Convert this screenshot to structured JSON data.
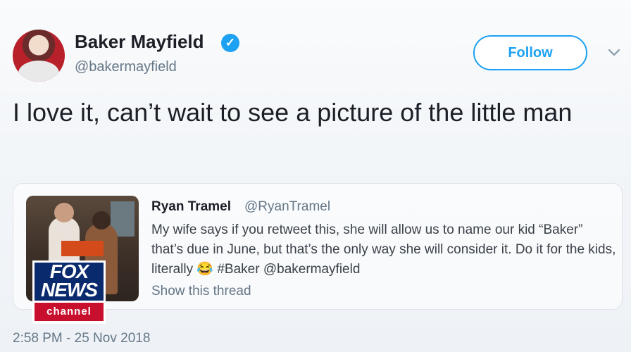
{
  "author": {
    "display_name": "Baker Mayfield",
    "handle": "@bakermayfield",
    "verified": true
  },
  "follow_label": "Follow",
  "tweet_text": "I love it, can’t wait to see a picture of the little man",
  "quoted_tweet": {
    "display_name": "Ryan Tramel",
    "handle": "@RyanTramel",
    "text_before_emoji": "My wife says if you retweet this, she will allow us to name our kid “Baker” that’s due in June, but that’s the only way she will consider it. Do it for the kids, literally ",
    "emoji": "😂",
    "text_after_emoji": " #Baker @bakermayfield",
    "show_thread_label": "Show this thread"
  },
  "overlay_logo": {
    "top_text": "FOX NEWS",
    "bottom_text": "channel"
  },
  "timestamp": "2:58 PM - 25 Nov 2018",
  "colors": {
    "accent": "#1da1f2",
    "muted": "#657786"
  }
}
